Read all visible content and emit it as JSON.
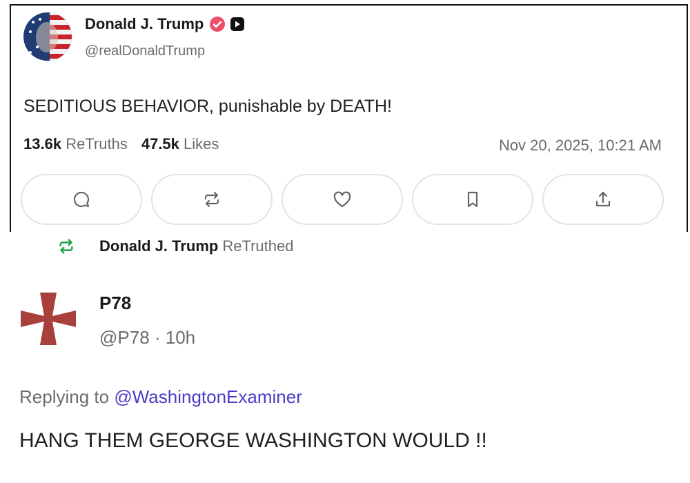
{
  "post": {
    "display_name": "Donald J. Trump",
    "handle": "@realDonaldTrump",
    "text": "SEDITIOUS BEHAVIOR, punishable by DEATH!",
    "retruths_count": "13.6k",
    "retruths_label": "ReTruths",
    "likes_count": "47.5k",
    "likes_label": "Likes",
    "timestamp": "Nov 20, 2025, 10:21 AM",
    "actions": [
      "reply-icon",
      "retruth-icon",
      "heart-icon",
      "bookmark-icon",
      "share-icon"
    ]
  },
  "retruth_banner": {
    "name": "Donald J. Trump",
    "label": "ReTruthed"
  },
  "reply_post": {
    "display_name": "P78",
    "handle_time": "@P78 · 10h",
    "replying_label": "Replying to",
    "replying_to": "@WashingtonExaminer",
    "text": "HANG THEM GEORGE WASHINGTON WOULD !!"
  },
  "colors": {
    "verified": "#ec4f6a",
    "retruth_green": "#1ea34a",
    "mention": "#4a3cc7",
    "cross": "#a8403c"
  }
}
